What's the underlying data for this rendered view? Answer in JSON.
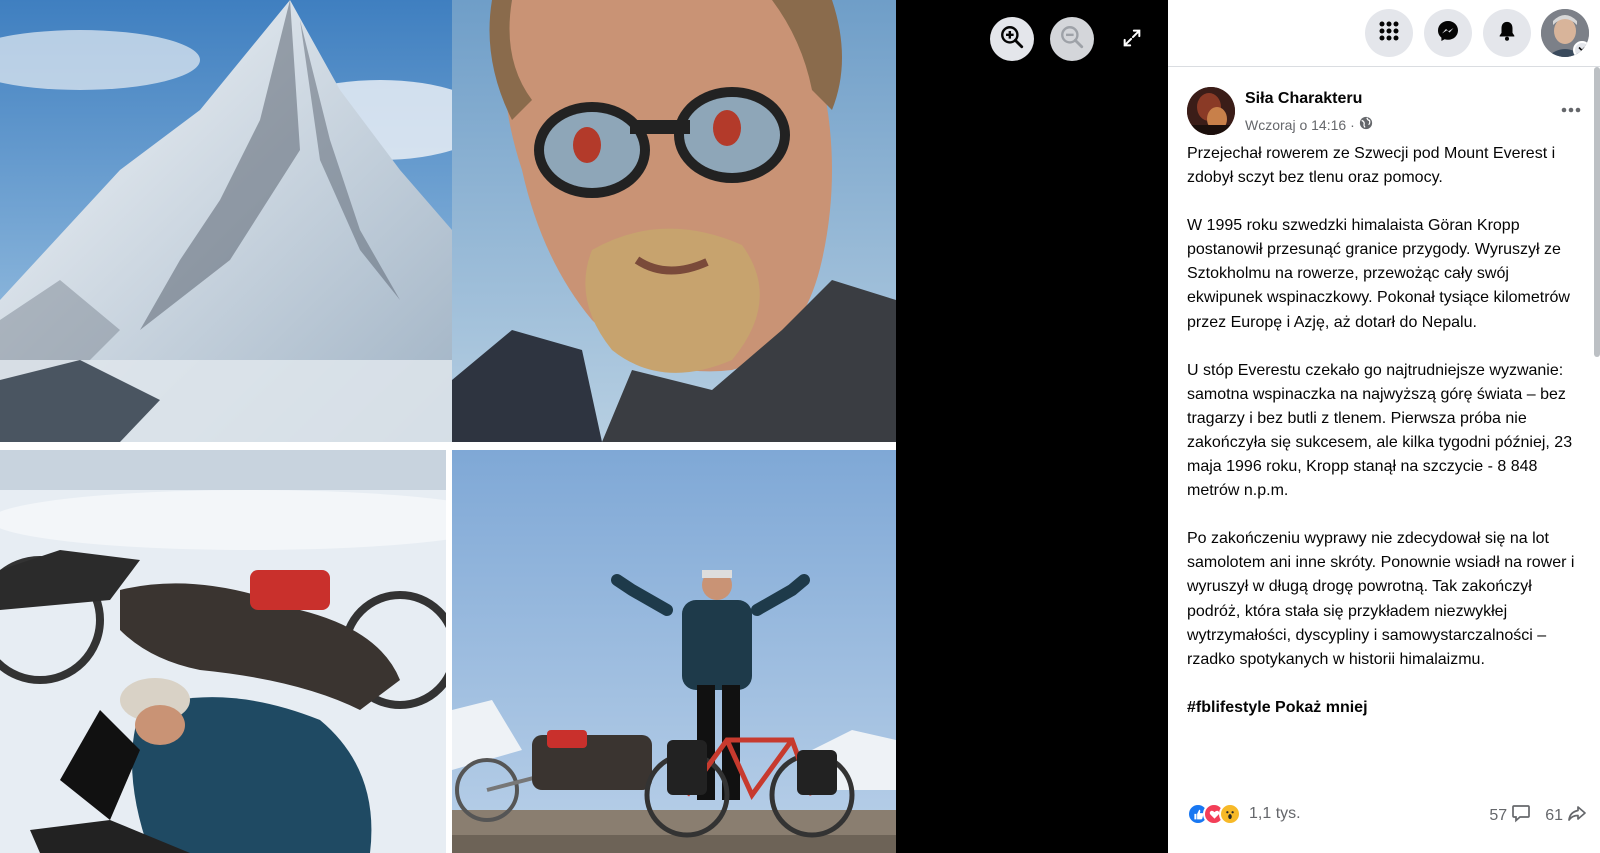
{
  "viewer": {
    "zoom_in_label": "Zoom in",
    "zoom_out_label": "Zoom out",
    "fullscreen_label": "Enter full screen"
  },
  "topbar": {
    "menu_icon": "grid-menu-icon",
    "messenger_icon": "messenger-icon",
    "notifications_icon": "bell-icon",
    "account_icon": "chevron-down-icon"
  },
  "post": {
    "page_name": "Siła Charakteru",
    "time": "Wczoraj o 14:16",
    "separator": "·",
    "paragraphs": [
      "Przejechał rowerem ze Szwecji pod Mount Everest i zdobył sczyt bez tlenu oraz pomocy.",
      "W 1995 roku szwedzki himalaista Göran Kropp postanowił przesunąć granice przygody. Wyruszył ze Sztokholmu na rowerze, przewożąc cały swój ekwipunek wspinaczkowy. Pokonał tysiące kilometrów przez Europę i Azję, aż dotarł do Nepalu.",
      "U stóp Everestu czekało go najtrudniejsze wyzwanie: samotna wspinaczka na najwyższą górę świata – bez tragarzy i bez butli z tlenem. Pierwsza próba nie zakończyła się sukcesem, ale kilka tygodni później, 23 maja 1996 roku, Kropp stanął na szczycie - 8 848 metrów n.p.m.",
      "Po zakończeniu wyprawy nie zdecydował się na lot samolotem ani inne skróty. Ponownie wsiadł na rower i wyruszył w długą drogę powrotną. Tak zakończył podróż, która stała się przykładem niezwykłej wytrzymałości, dyscypliny i samowystarczalności – rzadko spotykanych w historii himalaizmu."
    ],
    "hashtag": "#fblifestyle",
    "show_less": "Pokaż mniej"
  },
  "footer": {
    "reaction_count": "1,1 tys.",
    "comment_count": "57",
    "share_count": "61"
  },
  "colors": {
    "like": "#1877f2",
    "love": "#f33e58",
    "wow": "#f7b928",
    "secondary_text": "#65676b",
    "button_bg": "#e4e6eb"
  }
}
